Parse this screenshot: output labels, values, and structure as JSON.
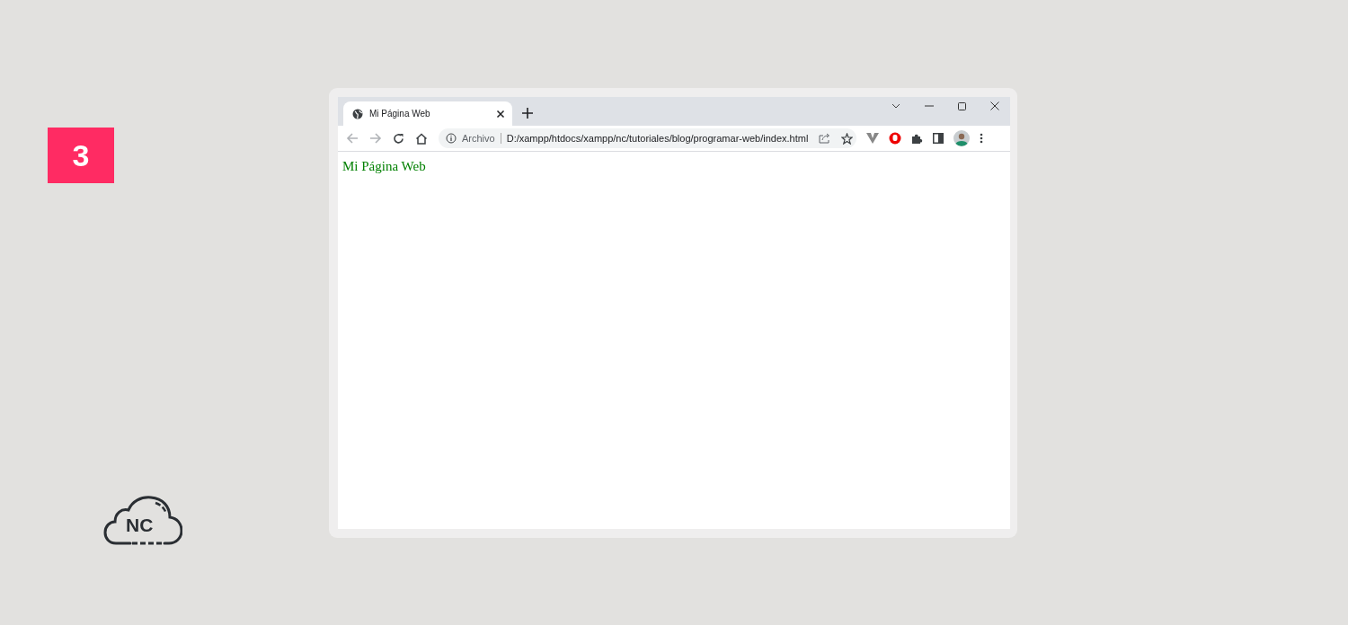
{
  "step_badge": "3",
  "logo": {
    "text": "NC"
  },
  "browser": {
    "tabs": [
      {
        "title": "Mi Página Web",
        "selected": true
      }
    ],
    "address": {
      "security_label": "Archivo",
      "url": "D:/xampp/htdocs/xampp/nc/tutoriales/blog/programar-web/index.html"
    },
    "page": {
      "heading": "Mi Página Web"
    }
  }
}
